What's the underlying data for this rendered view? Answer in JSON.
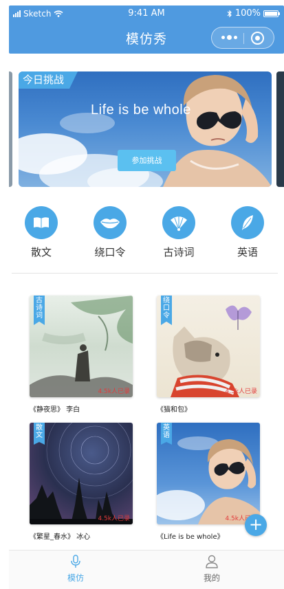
{
  "status": {
    "carrier": "Sketch",
    "time": "9:41 AM",
    "battery": "100%"
  },
  "nav": {
    "title": "模仿秀"
  },
  "banner": {
    "tag": "今日挑战",
    "text": "Life is be whole",
    "button": "参加挑战"
  },
  "categories": [
    {
      "label": "散文",
      "icon": "book-icon"
    },
    {
      "label": "绕口令",
      "icon": "lips-icon"
    },
    {
      "label": "古诗词",
      "icon": "fan-icon"
    },
    {
      "label": "英语",
      "icon": "feather-icon"
    }
  ],
  "cards": [
    {
      "tag": "古诗词",
      "count": "4.5k人已录",
      "caption": "《静夜思》 李白"
    },
    {
      "tag": "绕口令",
      "count": "4.5k人已录",
      "caption": "《猫和包》"
    },
    {
      "tag": "散文",
      "count": "4.5k人已录",
      "caption": "《繁星_春水》 冰心"
    },
    {
      "tag": "英语",
      "count": "4.5k人已录",
      "caption": "《Life is be whole》"
    }
  ],
  "fab": {
    "label": "+"
  },
  "tabs": [
    {
      "label": "模仿",
      "icon": "microphone-icon"
    },
    {
      "label": "我的",
      "icon": "user-icon"
    }
  ],
  "colors": {
    "primary": "#4aa8e6",
    "navbar": "#4f9ae0",
    "count": "#e23b3b"
  }
}
